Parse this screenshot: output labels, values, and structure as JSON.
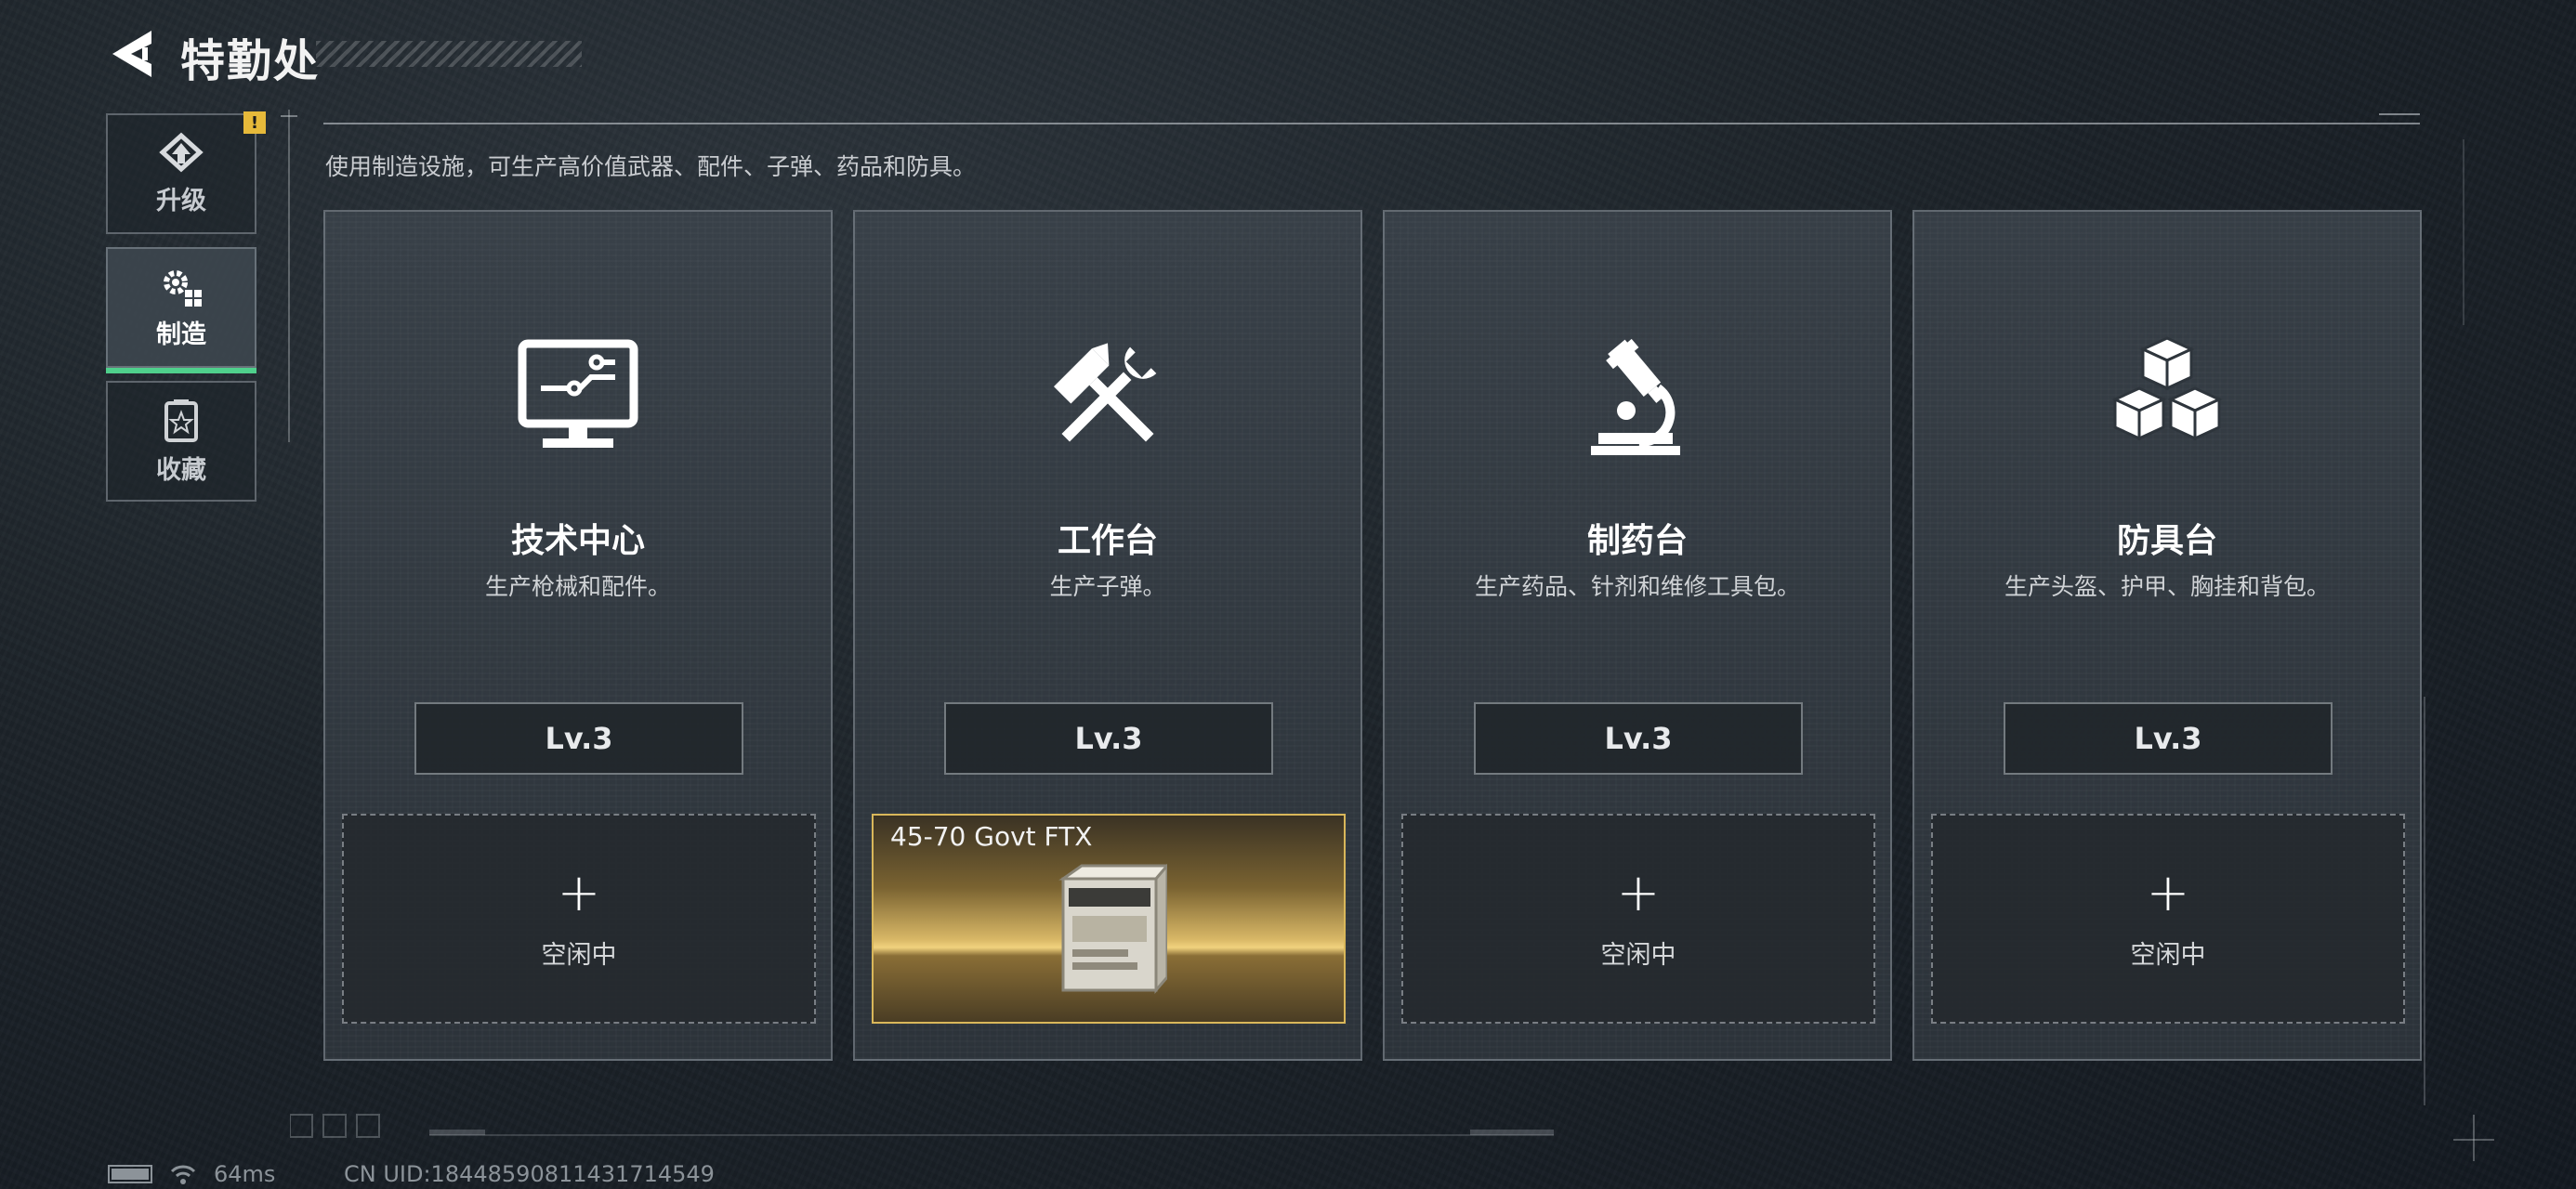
{
  "header": {
    "title": "特勤处",
    "description": "使用制造设施，可生产高价值武器、配件、子弹、药品和防具。"
  },
  "sidebar": {
    "tabs": [
      {
        "label": "升级",
        "icon": "upgrade-icon",
        "badge": "!"
      },
      {
        "label": "制造",
        "icon": "craft-gear-icon",
        "active": true
      },
      {
        "label": "收藏",
        "icon": "collection-icon"
      }
    ],
    "accent_color": "#4fd08c",
    "badge_color": "#e6b93a"
  },
  "stations": [
    {
      "name": "技术中心",
      "desc": "生产枪械和配件。",
      "level": "Lv.3",
      "icon": "monitor-icon",
      "slot": {
        "status": "空闲中"
      }
    },
    {
      "name": "工作台",
      "desc": "生产子弹。",
      "level": "Lv.3",
      "icon": "hammer-wrench-icon",
      "slot": {
        "item": "45-70 Govt FTX",
        "item_icon": "ammo-box-icon"
      }
    },
    {
      "name": "制药台",
      "desc": "生产药品、针剂和维修工具包。",
      "level": "Lv.3",
      "icon": "microscope-icon",
      "slot": {
        "status": "空闲中"
      }
    },
    {
      "name": "防具台",
      "desc": "生产头盔、护甲、胸挂和背包。",
      "level": "Lv.3",
      "icon": "cubes-icon",
      "slot": {
        "status": "空闲中"
      }
    }
  ],
  "footer": {
    "ping": "64ms",
    "uid": "CN UID:18448590811431714549"
  }
}
